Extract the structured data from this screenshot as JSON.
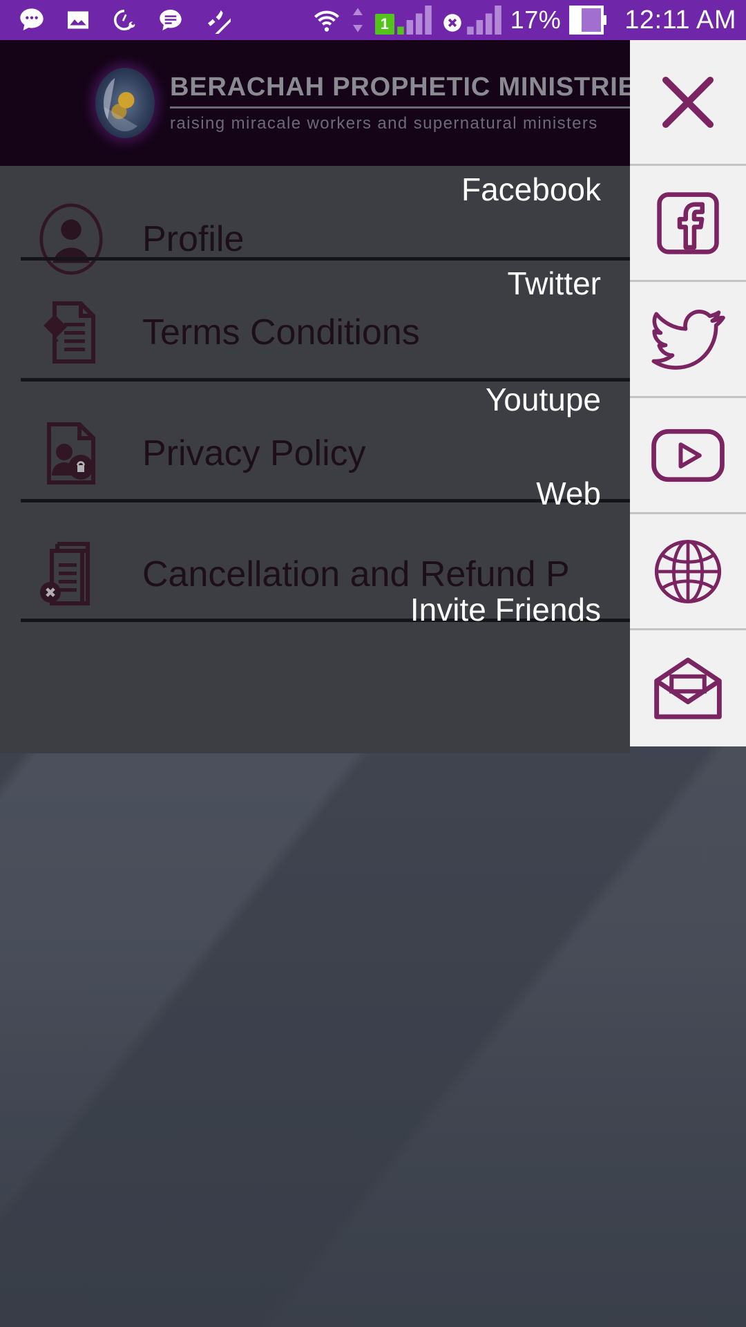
{
  "status_bar": {
    "background": "#7026a8",
    "notification_icons": [
      "chat-bubble-icon",
      "image-icon",
      "speedometer-wrench-icon",
      "message-icon",
      "mute-icon"
    ],
    "wifi_icon": "wifi-icon",
    "data-transfer_icon": "data-arrows-icon",
    "sim1_badge": "1",
    "sim1_signal_icon": "signal-bars-icon",
    "sim2_signal_icon": "signal-bars-no-service-icon",
    "battery_percent": "17%",
    "battery_icon": "battery-icon",
    "clock": "12:11 AM"
  },
  "app_header": {
    "menu_icon": "hamburger-menu-icon",
    "logo_icon": "globe-hand-logo",
    "title": "BERACHAH PROPHETIC MINISTRIES",
    "tagline": "raising miracale workers and supernatural ministers",
    "background": "#150418"
  },
  "drawer": {
    "items": [
      {
        "label": "Profile",
        "icon": "profile-avatar-icon"
      },
      {
        "label": "Terms Conditions",
        "icon": "document-pencil-icon"
      },
      {
        "label": "Privacy Policy",
        "icon": "document-person-lock-icon"
      },
      {
        "label": "Cancellation and Refund P",
        "icon": "document-cancel-icon"
      }
    ],
    "text_color": "#1d0a18"
  },
  "share_panel": {
    "accent": "#7a2561",
    "background": "#f1f1f1",
    "close_icon": "close-x-icon",
    "entries": [
      {
        "label": "Facebook",
        "icon": "facebook-icon"
      },
      {
        "label": "Twitter",
        "icon": "twitter-bird-icon"
      },
      {
        "label": "Youtupe",
        "icon": "youtube-icon"
      },
      {
        "label": "Web",
        "icon": "globe-web-icon"
      },
      {
        "label": "Invite Friends",
        "icon": "envelope-open-icon"
      }
    ]
  }
}
